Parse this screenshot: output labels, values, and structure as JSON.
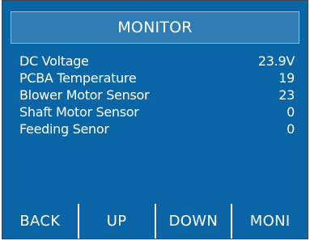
{
  "title": "MONITOR",
  "rows": [
    {
      "label": "DC Voltage",
      "value": "23.9V"
    },
    {
      "label": "PCBA Temperature",
      "value": "19"
    },
    {
      "label": "Blower Motor Sensor",
      "value": "23"
    },
    {
      "label": "Shaft Motor Sensor",
      "value": "0"
    },
    {
      "label": "Feeding Senor",
      "value": "0"
    }
  ],
  "buttons": {
    "back": "BACK",
    "up": "UP",
    "down": "DOWN",
    "moni": "MONI"
  },
  "colors": {
    "screen_bg": "#0a65a6",
    "title_bg": "#2f7db4",
    "text": "#ffffff"
  }
}
